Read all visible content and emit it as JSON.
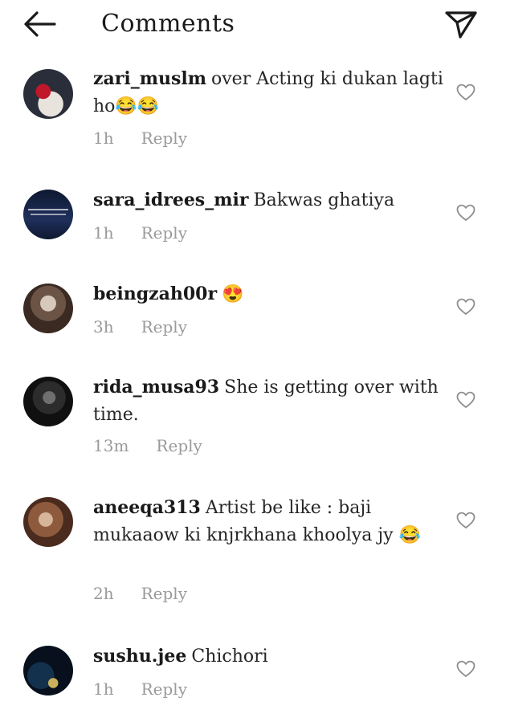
{
  "header": {
    "title": "Comments",
    "back_icon": "arrow-left-icon",
    "share_icon": "paper-plane-icon"
  },
  "reply_label": "Reply",
  "comments": [
    {
      "username": "zari_muslm",
      "text": "over Acting ki dukan lagti ho😂😂",
      "time": "1h",
      "avatar_colors": [
        "#2a2e3a",
        "#c0182a",
        "#e8e3dc"
      ]
    },
    {
      "username": "sara_idrees_mir",
      "text": "Bakwas ghatiya",
      "time": "1h",
      "avatar_colors": [
        "#0e1830",
        "#1f2f5a",
        "#d9d9e6"
      ]
    },
    {
      "username": "beingzah00r",
      "text": "😍",
      "time": "3h",
      "avatar_colors": [
        "#3a2a22",
        "#6b5446",
        "#d6c9bc"
      ]
    },
    {
      "username": "rida_musa93",
      "text": "She is getting over with time.",
      "time": "13m",
      "avatar_colors": [
        "#101010",
        "#2c2c2c",
        "#6f6f6f"
      ]
    },
    {
      "username": "aneeqa313",
      "text": "Artist be like : baji mukaaow ki knjrkhana khoolya jy 😂",
      "time": "2h",
      "avatar_colors": [
        "#4a2b1e",
        "#8e5a3e",
        "#d7b59b"
      ]
    },
    {
      "username": "sushu.jee",
      "text": "Chichori",
      "time": "1h",
      "avatar_colors": [
        "#07101c",
        "#13304d",
        "#c9b15a"
      ]
    }
  ]
}
